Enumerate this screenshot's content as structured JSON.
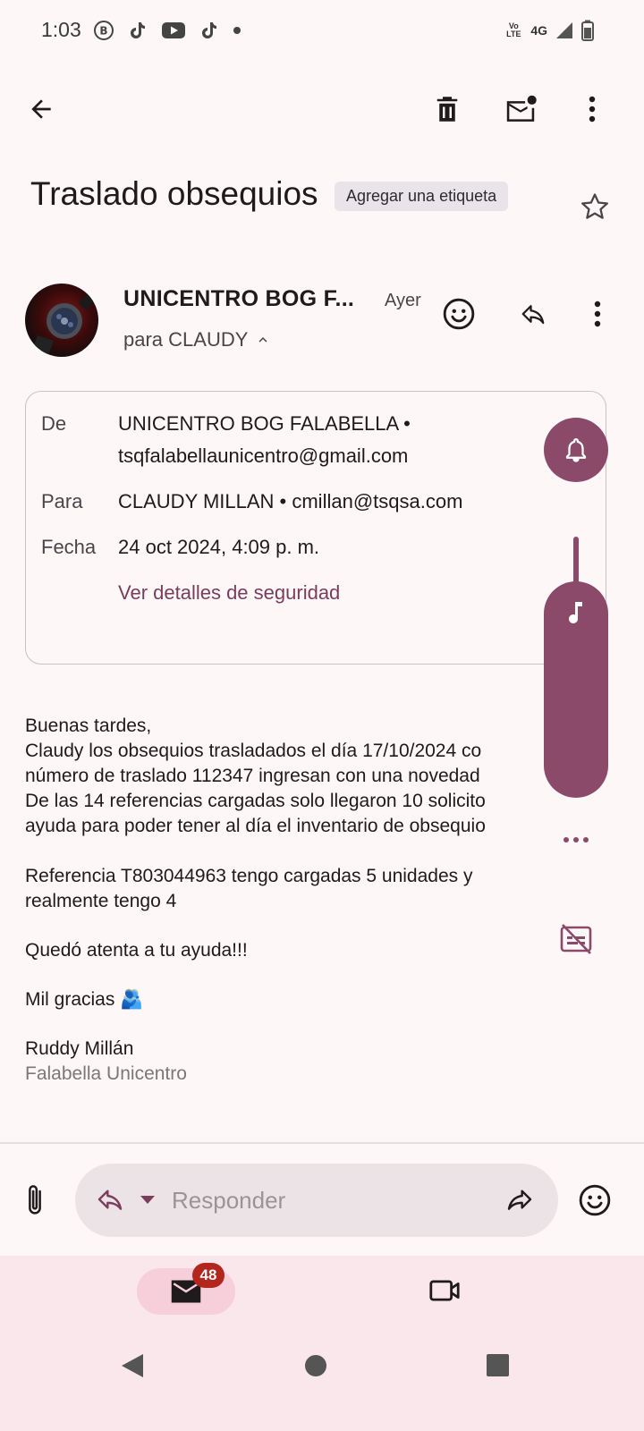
{
  "status_bar": {
    "time": "1:03",
    "network": "4G",
    "volte": "Vo LTE"
  },
  "toolbar": {
    "back_icon": "arrow-left-icon",
    "delete_icon": "trash-icon",
    "mark_unread_icon": "mail-unread-icon",
    "more_icon": "more-vert-icon"
  },
  "email": {
    "subject": "Traslado obsequios",
    "label_chip": "Agregar una etiqueta",
    "sender_short": "UNICENTRO BOG F...",
    "time": "Ayer",
    "to_line": "para CLAUDY",
    "details": {
      "from_label": "De",
      "from_name": "UNICENTRO BOG FALABELLA •",
      "from_email": "tsqfalabellaunicentro@gmail.com",
      "to_label": "Para",
      "to_value": "CLAUDY MILLAN • cmillan@tsqsa.com",
      "date_label": "Fecha",
      "date_value": "24 oct 2024, 4:09 p. m.",
      "security_link": "Ver detalles de seguridad"
    },
    "body": {
      "greeting": "Buenas tardes,",
      "line1": "Claudy los obsequios trasladados el día 17/10/2024 co",
      "line2": "número de traslado 112347 ingresan con una novedad",
      "line3": "De las 14 referencias cargadas solo llegaron 10 solicito",
      "line4": "ayuda para poder tener al día el inventario de obsequio",
      "ref1": "Referencia T803044963 tengo cargadas 5 unidades y",
      "ref2": "realmente tengo 4",
      "closing1": "Quedó atenta a tu ayuda!!!",
      "closing2": "Mil gracias 🫂",
      "signature_name": "Ruddy Millán",
      "signature_org": "Falabella Unicentro"
    }
  },
  "reply_bar": {
    "placeholder": "Responder"
  },
  "bottom_nav": {
    "mail_badge": "48"
  },
  "colors": {
    "accent": "#8c4a6a",
    "link": "#7b3d5c",
    "badge": "#b3261e",
    "nav_bg": "#fae7ec"
  }
}
